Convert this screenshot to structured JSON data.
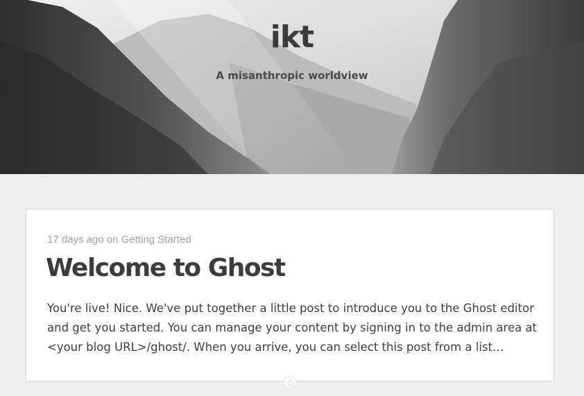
{
  "header": {
    "site_title": "ikt",
    "site_description": "A misanthropic worldview"
  },
  "post": {
    "date": "17 days ago",
    "on_word": "on",
    "tag": "Getting Started",
    "title": "Welcome to Ghost",
    "excerpt": "You're live! Nice. We've put together a little post to introduce you to the Ghost editor and get you started. You can manage your content by signing in to the admin area at <your blog URL>/ghost/. When you arrive, you can select this post from a list…"
  },
  "colors": {
    "page_background": "#eeeeee",
    "card_background": "#ffffff",
    "meta_text": "#9aa3a8",
    "title_text": "#3c3c3c"
  }
}
